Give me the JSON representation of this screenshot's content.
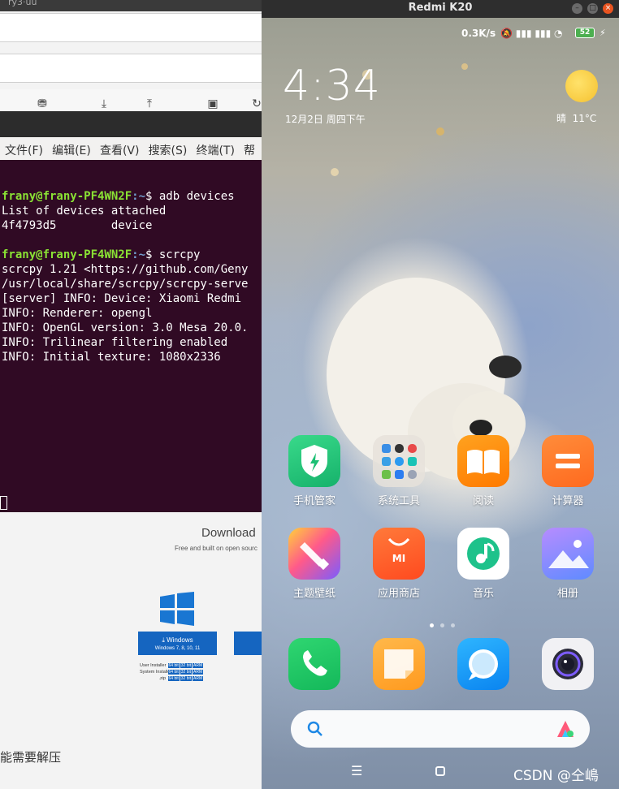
{
  "background_window": {
    "title_fragment": "ry3·uu"
  },
  "terminal": {
    "menu": [
      "文件(F)",
      "编辑(E)",
      "查看(V)",
      "搜索(S)",
      "终端(T)",
      "帮"
    ],
    "lines": [
      {
        "user": "frany@frany-PF4WN2F",
        "path": ":~",
        "cmd": "$ adb devices"
      },
      {
        "text": "List of devices attached"
      },
      {
        "text": "4f4793d5        device"
      },
      {
        "text": ""
      },
      {
        "user": "frany@frany-PF4WN2F",
        "path": ":~",
        "cmd": "$ scrcpy"
      },
      {
        "text": "scrcpy 1.21 <https://github.com/Geny"
      },
      {
        "text": "/usr/local/share/scrcpy/scrcpy-serve"
      },
      {
        "text": "[server] INFO: Device: Xiaomi Redmi "
      },
      {
        "text": "INFO: Renderer: opengl"
      },
      {
        "text": "INFO: OpenGL version: 3.0 Mesa 20.0."
      },
      {
        "text": "INFO: Trilinear filtering enabled"
      },
      {
        "text": "INFO: Initial texture: 1080x2336"
      }
    ]
  },
  "download_page": {
    "title": "Download",
    "subtitle": "Free and built on open sourc",
    "windows_button": {
      "label": "Windows",
      "sub": "Windows 7, 8, 10, 11"
    },
    "installer_rows": [
      {
        "label": "User Installer",
        "chips": [
          "64 bit",
          "32 bit",
          "ARM"
        ]
      },
      {
        "label": "System Installer",
        "chips": [
          "64 bit",
          "32 bit",
          "ARM"
        ]
      },
      {
        "label": ".zip",
        "chips": [
          "64 bit",
          "32 bit",
          "ARM"
        ]
      }
    ],
    "bottom_text": "能需要解压"
  },
  "phone": {
    "window_title": "Redmi K20",
    "status": {
      "speed": "0.3K/s",
      "battery": "52"
    },
    "clock": "4:34",
    "date": "12月2日 周四下午",
    "weather": {
      "condition": "晴",
      "temp": "11°C"
    },
    "apps_row1": [
      {
        "label": "手机管家",
        "color": "#2ecb7a"
      },
      {
        "label": "系统工具",
        "color": "#c9c4bb"
      },
      {
        "label": "阅读",
        "color": "#ff8a00"
      },
      {
        "label": "计算器",
        "color": "#ff7a2f"
      }
    ],
    "apps_row2": [
      {
        "label": "主题壁纸",
        "color": "#ff4f9a"
      },
      {
        "label": "应用商店",
        "color": "#ff6a2b"
      },
      {
        "label": "音乐",
        "color": "#ffffff"
      },
      {
        "label": "相册",
        "color": "#6f8cff"
      }
    ],
    "dock": [
      {
        "name": "phone",
        "color": "#20c863"
      },
      {
        "name": "notes",
        "color": "#ffa83a"
      },
      {
        "name": "messages",
        "color": "#1e9bf5"
      },
      {
        "name": "camera",
        "color": "#f2f2f5"
      }
    ],
    "watermark": "CSDN @仝嶋"
  }
}
